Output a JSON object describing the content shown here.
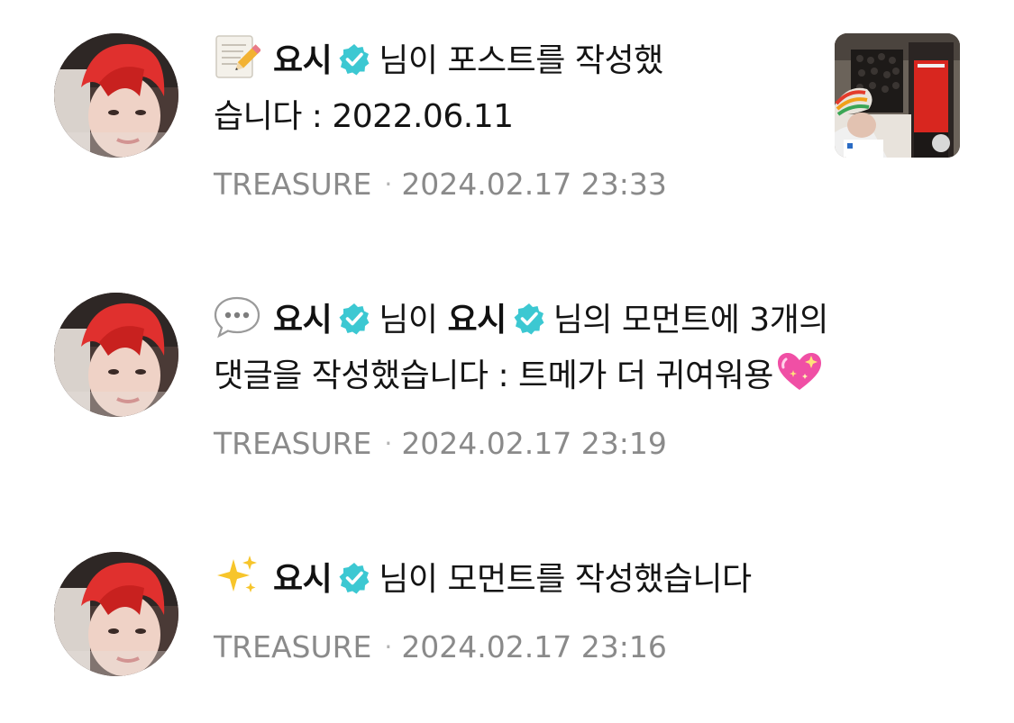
{
  "feed": {
    "notifications": [
      {
        "icon": "memo-icon",
        "author": "요시",
        "action_line1": "님이 포스트를 작성했",
        "action_line2": "습니다 : 2022.06.11",
        "group": "TREASURE",
        "separator": "·",
        "timestamp": "2024.02.17 23:33",
        "has_thumbnail": true
      },
      {
        "icon": "speech-bubble-icon",
        "author": "요시",
        "mid_text": "님이",
        "target": "요시",
        "action_line1": "님의 모먼트에 3개의",
        "action_line2": "댓글을 작성했습니다 : 트메가 더 귀여워용",
        "trailing_emoji": "sparkling-heart-icon",
        "group": "TREASURE",
        "separator": "·",
        "timestamp": "2024.02.17 23:19"
      },
      {
        "icon": "sparkles-icon",
        "author": "요시",
        "action_line1": "님이 모먼트를 작성했습니다",
        "group": "TREASURE",
        "separator": "·",
        "timestamp": "2024.02.17 23:16"
      }
    ]
  },
  "colors": {
    "verified_badge": "#3cc8d2",
    "meta_text": "#8a8a8a",
    "primary_text": "#141414"
  }
}
